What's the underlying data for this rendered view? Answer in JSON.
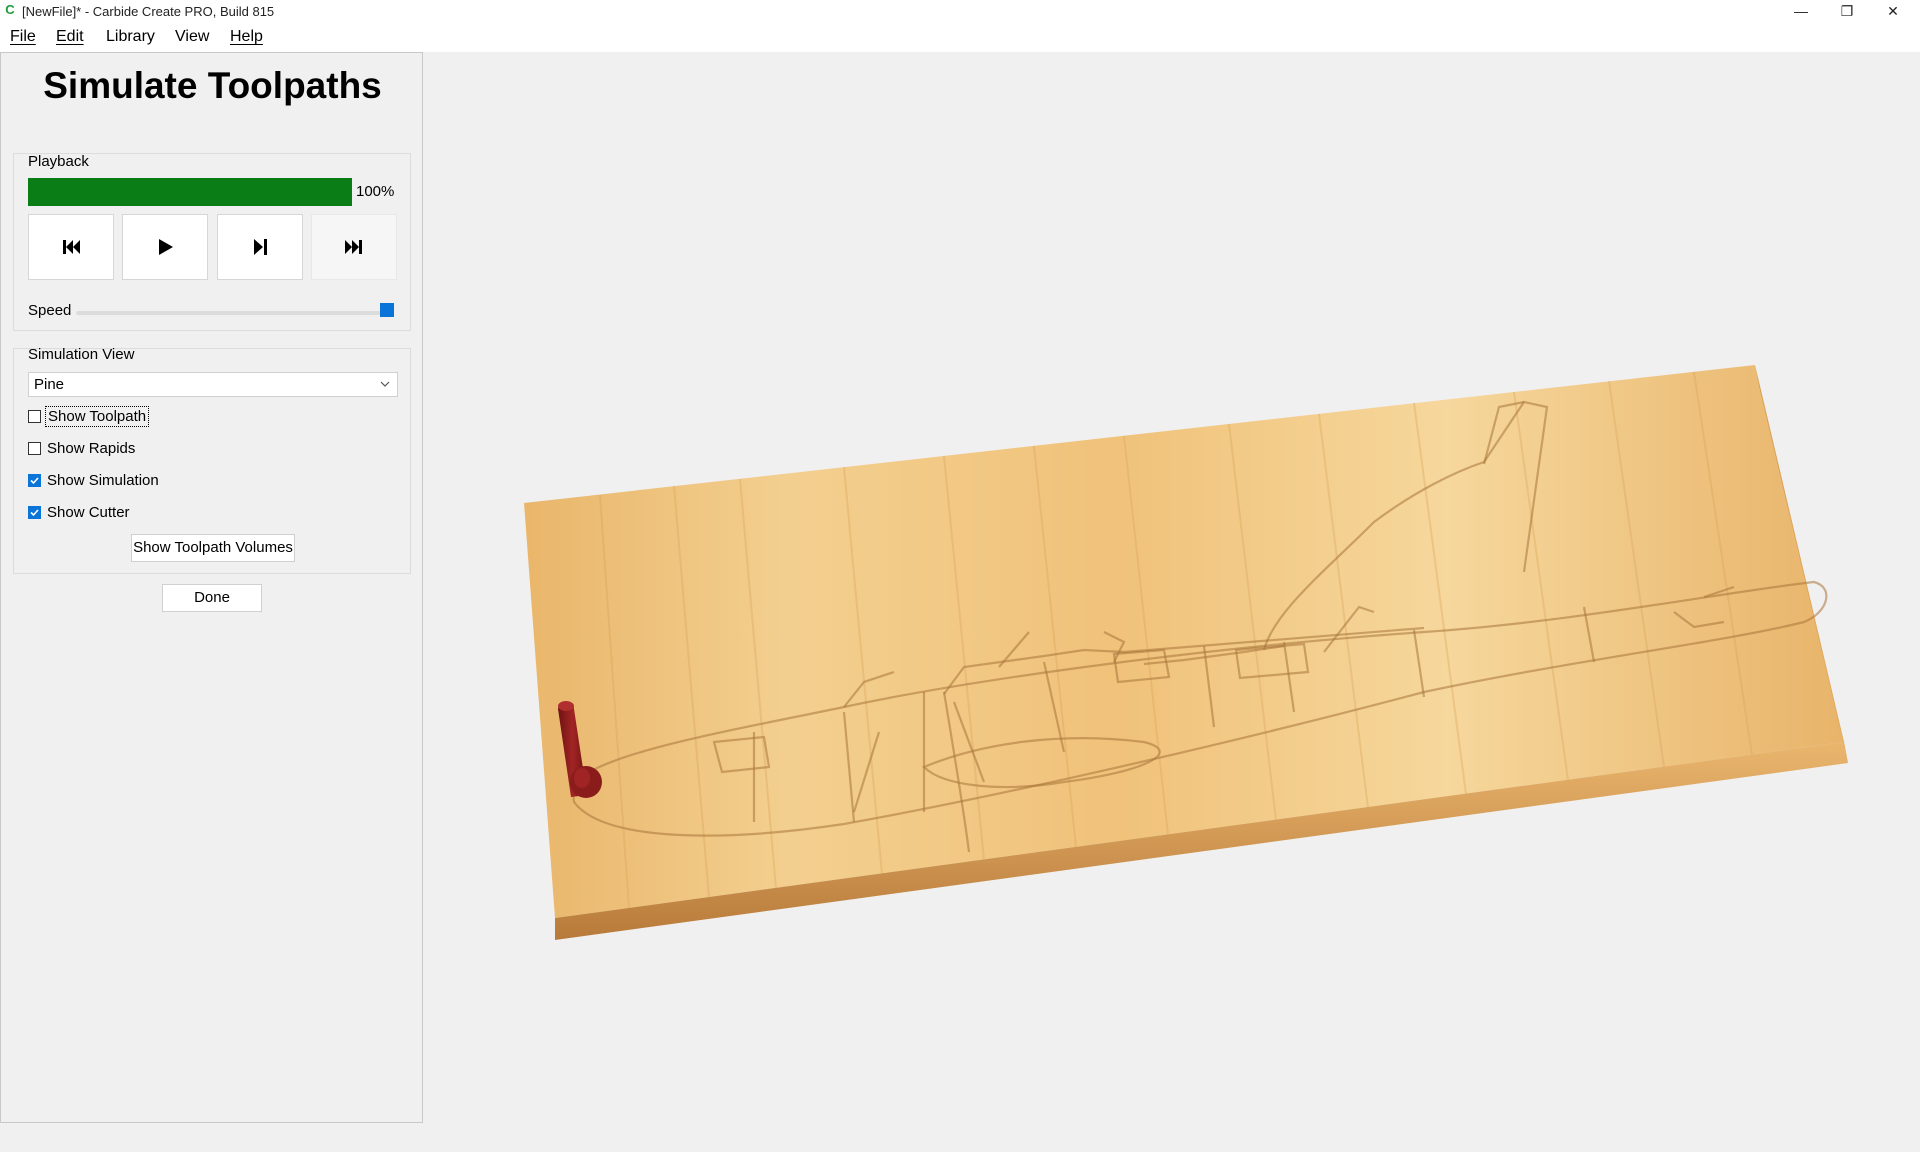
{
  "window": {
    "title": "[NewFile]* - Carbide Create PRO, Build 815",
    "logo_glyph": "C",
    "minimize_glyph": "—",
    "maximize_glyph": "❐",
    "close_glyph": "✕"
  },
  "menu": {
    "file": "File",
    "edit": "Edit",
    "library": "Library",
    "view": "View",
    "help": "Help"
  },
  "panel": {
    "title": "Simulate Toolpaths",
    "playback": {
      "label": "Playback",
      "progress_percent": 100,
      "progress_text": "100%",
      "speed_label": "Speed",
      "speed_fraction": 1.0,
      "buttons": [
        "skip-to-start",
        "play",
        "step-forward",
        "skip-to-end"
      ]
    },
    "simulation_view": {
      "label": "Simulation View",
      "material_value": "Pine",
      "options": [
        {
          "label": "Show Toolpath",
          "checked": false
        },
        {
          "label": "Show Rapids",
          "checked": false
        },
        {
          "label": "Show Simulation",
          "checked": true
        },
        {
          "label": "Show Cutter",
          "checked": true
        }
      ],
      "volumes_button": "Show Toolpath Volumes"
    },
    "done_button": "Done"
  },
  "viewport": {
    "colors": {
      "background": "#f0f0f0",
      "wood_light": "#f3cf8f",
      "wood_mid": "#e8b56b",
      "wood_dark": "#c98c45",
      "cutter": "#8a1c1c"
    },
    "carving_subject": "airplane-relief",
    "cutter_icon": "end-mill-cutter"
  }
}
